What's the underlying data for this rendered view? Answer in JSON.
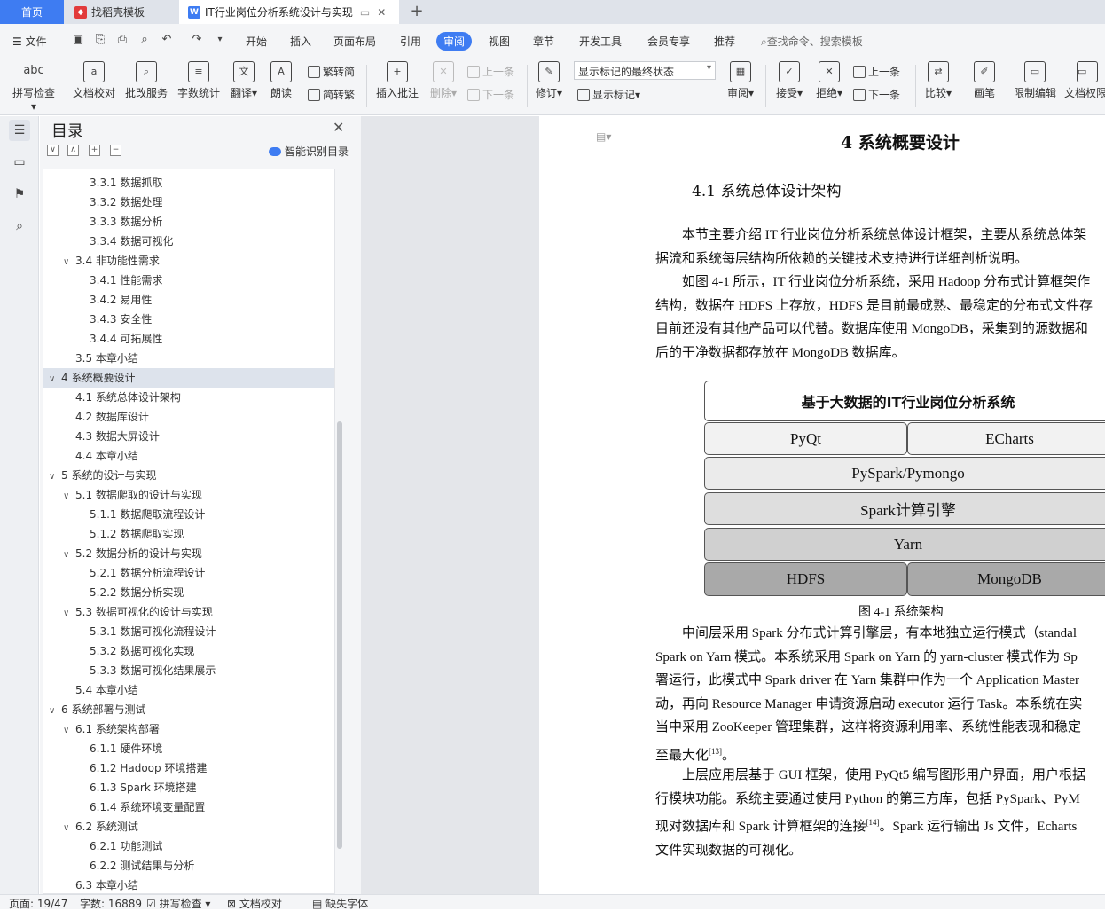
{
  "tabs": {
    "home": "首页",
    "template": "找稻壳模板",
    "document": "IT行业岗位分析系统设计与实现"
  },
  "menu": {
    "file": "文件",
    "items": [
      "开始",
      "插入",
      "页面布局",
      "引用",
      "审阅",
      "视图",
      "章节",
      "开发工具",
      "会员专享",
      "推荐"
    ],
    "search": "查找命令、搜索模板"
  },
  "ribbon": {
    "spellcheck": "拼写检查",
    "doc_check": "文档校对",
    "batch_service": "批改服务",
    "word_count": "字数统计",
    "translate": "翻译",
    "read_aloud": "朗读",
    "trad_to_simp": "繁转简",
    "simp_to_trad": "简转繁",
    "insert_comment": "插入批注",
    "delete": "删除",
    "prev": "上一条",
    "next": "下一条",
    "revise": "修订",
    "markup_state": "显示标记的最终状态",
    "show_markup": "显示标记",
    "review": "审阅",
    "accept": "接受",
    "reject": "拒绝",
    "prev2": "上一条",
    "next2": "下一条",
    "compare": "比较",
    "pen": "画笔",
    "restrict_edit": "限制编辑",
    "doc_permission": "文档权限"
  },
  "toc": {
    "title": "目录",
    "smart": "智能识别目录",
    "items": [
      {
        "level": 3,
        "text": "3.3.1  数据抓取"
      },
      {
        "level": 3,
        "text": "3.3.2  数据处理"
      },
      {
        "level": 3,
        "text": "3.3.3  数据分析"
      },
      {
        "level": 3,
        "text": "3.3.4  数据可视化"
      },
      {
        "level": 2,
        "text": "3.4  非功能性需求",
        "toggle": "∨"
      },
      {
        "level": 3,
        "text": "3.4.1  性能需求"
      },
      {
        "level": 3,
        "text": "3.4.2  易用性"
      },
      {
        "level": 3,
        "text": "3.4.3  安全性"
      },
      {
        "level": 3,
        "text": "3.4.4  可拓展性"
      },
      {
        "level": 2,
        "text": "3.5  本章小结"
      },
      {
        "level": 1,
        "text": "4  系统概要设计",
        "toggle": "∨",
        "selected": true
      },
      {
        "level": 2,
        "text": "4.1  系统总体设计架构"
      },
      {
        "level": 2,
        "text": "4.2  数据库设计"
      },
      {
        "level": 2,
        "text": "4.3  数据大屏设计"
      },
      {
        "level": 2,
        "text": "4.4  本章小结"
      },
      {
        "level": 1,
        "text": "5  系统的设计与实现",
        "toggle": "∨"
      },
      {
        "level": 2,
        "text": "5.1  数据爬取的设计与实现",
        "toggle": "∨"
      },
      {
        "level": 3,
        "text": "5.1.1  数据爬取流程设计"
      },
      {
        "level": 3,
        "text": "5.1.2  数据爬取实现"
      },
      {
        "level": 2,
        "text": "5.2  数据分析的设计与实现",
        "toggle": "∨"
      },
      {
        "level": 3,
        "text": "5.2.1  数据分析流程设计"
      },
      {
        "level": 3,
        "text": "5.2.2  数据分析实现"
      },
      {
        "level": 2,
        "text": "5.3  数据可视化的设计与实现",
        "toggle": "∨"
      },
      {
        "level": 3,
        "text": "5.3.1  数据可视化流程设计"
      },
      {
        "level": 3,
        "text": "5.3.2  数据可视化实现"
      },
      {
        "level": 3,
        "text": "5.3.3  数据可视化结果展示"
      },
      {
        "level": 2,
        "text": "5.4  本章小结"
      },
      {
        "level": 1,
        "text": "6  系统部署与测试",
        "toggle": "∨"
      },
      {
        "level": 2,
        "text": "6.1  系统架构部署",
        "toggle": "∨"
      },
      {
        "level": 3,
        "text": "6.1.1  硬件环境"
      },
      {
        "level": 3,
        "text": "6.1.2 Hadoop 环境搭建"
      },
      {
        "level": 3,
        "text": "6.1.3 Spark 环境搭建"
      },
      {
        "level": 3,
        "text": "6.1.4  系统环境变量配置"
      },
      {
        "level": 2,
        "text": "6.2  系统测试",
        "toggle": "∨"
      },
      {
        "level": 3,
        "text": "6.2.1  功能测试"
      },
      {
        "level": 3,
        "text": "6.2.2  测试结果与分析"
      },
      {
        "level": 2,
        "text": "6.3  本章小结"
      }
    ]
  },
  "document": {
    "chapter_title": "4  系统概要设计",
    "section_title": "4.1  系统总体设计架构",
    "para1": [
      "　　本节主要介绍 IT 行业岗位分析系统总体设计框架，主要从系统总体架",
      "据流和系统每层结构所依赖的关键技术支持进行详细剖析说明。"
    ],
    "para2": [
      "　　如图 4-1 所示，IT 行业岗位分析系统，采用 Hadoop 分布式计算框架作",
      "结构，数据在 HDFS 上存放，HDFS 是目前最成熟、最稳定的分布式文件存",
      "目前还没有其他产品可以代替。数据库使用 MongoDB，采集到的源数据和",
      "后的干净数据都存放在 MongoDB 数据库。"
    ],
    "figure": {
      "title": "基于大数据的IT行业岗位分析系统",
      "rows": [
        [
          "PyQt",
          "ECharts"
        ],
        [
          "PySpark/Pymongo"
        ],
        [
          "Spark计算引擎"
        ],
        [
          "Yarn"
        ],
        [
          "HDFS",
          "MongoDB"
        ]
      ],
      "caption": "图 4-1     系统架构"
    },
    "para3": [
      "　　中间层采用 Spark 分布式计算引擎层，有本地独立运行模式（standal",
      "Spark on Yarn 模式。本系统采用 Spark on Yarn 的 yarn-cluster 模式作为 Sp",
      "署运行，此模式中 Spark driver 在 Yarn 集群中作为一个 Application Master",
      "动，再向 Resource Manager 申请资源启动 executor 运行 Task。本系统在实",
      "当中采用 ZooKeeper 管理集群，这样将资源利用率、系统性能表现和稳定",
      "至最大化"
    ],
    "para3_ref": "[13]",
    "para3_end": "。",
    "para4": [
      "　　上层应用层基于 GUI 框架，使用 PyQt5 编写图形用户界面，用户根据",
      "行模块功能。系统主要通过使用 Python 的第三方库，包括 PySpark、PyM",
      "现对数据库和 Spark 计算框架的连接"
    ],
    "para4_ref": "[14]",
    "para4_tail": "。Spark 运行输出 Js 文件，Echarts",
    "para4_last": "文件实现数据的可视化。"
  },
  "status": {
    "page": "页面: 19/47",
    "words": "字数: 16889",
    "spell": "拼写检查",
    "proof": "文档校对",
    "missing_font": "缺失字体"
  }
}
